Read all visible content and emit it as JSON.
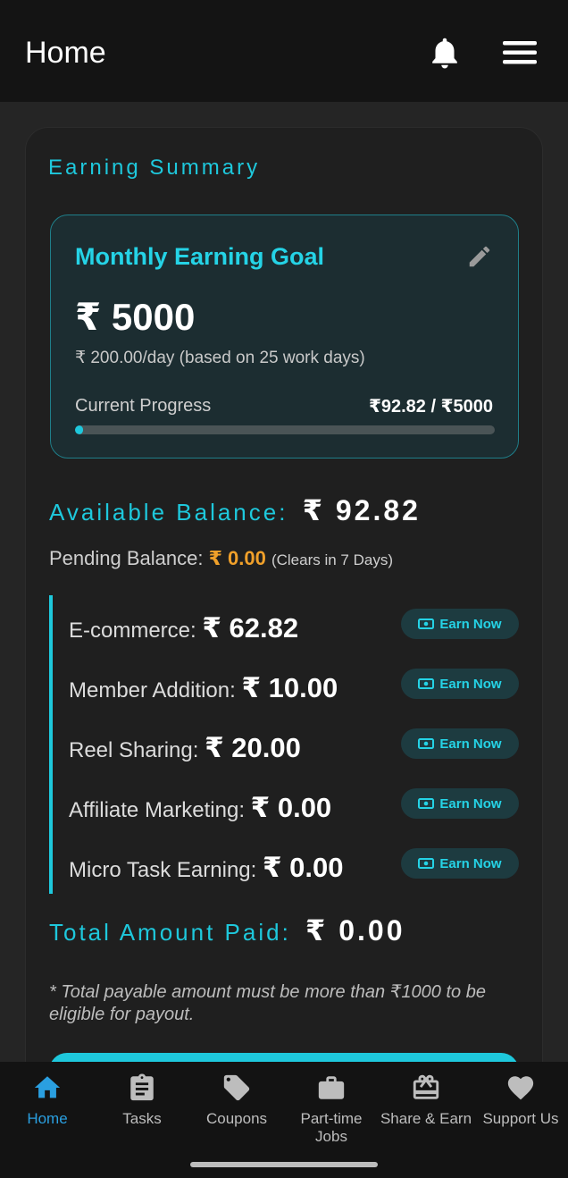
{
  "appbar": {
    "title": "Home",
    "icons": [
      "bell-icon",
      "menu-icon"
    ]
  },
  "summary": {
    "section_title": "Earning Summary",
    "goal": {
      "title": "Monthly Earning Goal",
      "amount": "₹ 5000",
      "subtitle": "₹ 200.00/day (based on 25 work days)",
      "progress_label": "Current Progress",
      "progress_value": "₹92.82 / ₹5000",
      "progress_fraction": 0.0186
    },
    "available_label": "Available Balance:",
    "available_value": "₹ 92.82",
    "pending_label": "Pending Balance:",
    "pending_value": "₹ 0.00",
    "pending_note": "(Clears in 7 Days)",
    "breakdown": [
      {
        "label": "E-commerce:",
        "value": "₹ 62.82",
        "button": "Earn Now"
      },
      {
        "label": "Member Addition:",
        "value": "₹ 10.00",
        "button": "Earn Now"
      },
      {
        "label": "Reel Sharing:",
        "value": "₹ 20.00",
        "button": "Earn Now"
      },
      {
        "label": "Affiliate Marketing:",
        "value": "₹ 0.00",
        "button": "Earn Now"
      },
      {
        "label": "Micro Task Earning:",
        "value": "₹ 0.00",
        "button": "Earn Now"
      }
    ],
    "total_label": "Total Amount Paid:",
    "total_value": "₹ 0.00",
    "disclaimer": "* Total payable amount must be more than ₹1000 to be eligible for payout."
  },
  "bottom_nav": [
    {
      "label": "Home",
      "icon": "home-icon",
      "active": true
    },
    {
      "label": "Tasks",
      "icon": "clipboard-icon",
      "active": false
    },
    {
      "label": "Coupons",
      "icon": "tag-icon",
      "active": false
    },
    {
      "label": "Part-time Jobs",
      "icon": "briefcase-icon",
      "active": false
    },
    {
      "label": "Share & Earn",
      "icon": "gift-icon",
      "active": false
    },
    {
      "label": "Support Us",
      "icon": "heart-icon",
      "active": false
    }
  ],
  "colors": {
    "accent": "#1ec8dc",
    "pending": "#f0a02a",
    "nav_active": "#2a9fe0"
  }
}
